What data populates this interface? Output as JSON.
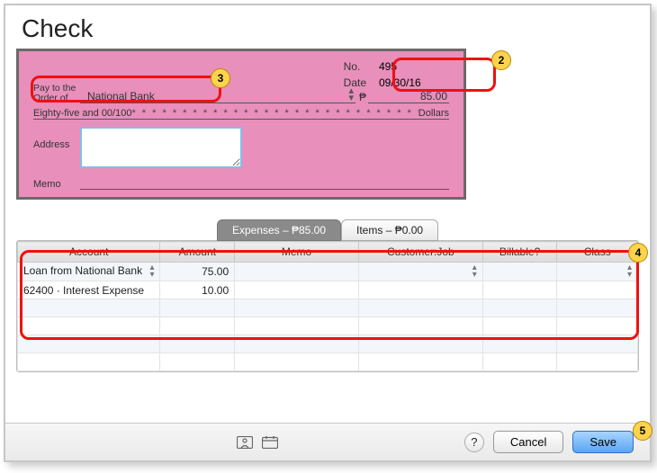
{
  "title": "Check",
  "check": {
    "no_label": "No.",
    "no_value": "495",
    "date_label": "Date",
    "date_value": "09/30/16",
    "payto_label_line1": "Pay to the",
    "payto_label_line2": "Order of",
    "payto_value": "National Bank",
    "amount_currency": "₱",
    "amount_value": "85.00",
    "amount_words": "Eighty-five and 00/100",
    "dollars_label": "Dollars",
    "address_label": "Address",
    "memo_label": "Memo"
  },
  "tabs": {
    "expenses": "Expenses – ₱85.00",
    "items": "Items – ₱0.00"
  },
  "table": {
    "headers": {
      "account": "Account",
      "amount": "Amount",
      "memo": "Memo",
      "customer": "Customer:Job",
      "billable": "Billable?",
      "class": "Class"
    },
    "rows": [
      {
        "account": "Loan from National Bank",
        "amount": "75.00",
        "memo": "",
        "customer": "",
        "billable": "",
        "class": ""
      },
      {
        "account": "62400 · Interest Expense",
        "amount": "10.00",
        "memo": "",
        "customer": "",
        "billable": "",
        "class": ""
      }
    ]
  },
  "bottom": {
    "help": "?",
    "cancel": "Cancel",
    "save": "Save"
  },
  "callouts": {
    "c2": "2",
    "c3": "3",
    "c4": "4",
    "c5": "5"
  }
}
